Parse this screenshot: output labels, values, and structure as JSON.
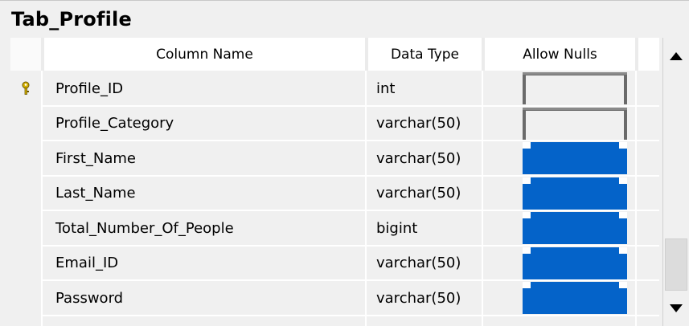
{
  "table": {
    "title": "Tab_Profile",
    "headers": {
      "column_name": "Column Name",
      "data_type": "Data Type",
      "allow_nulls": "Allow Nulls"
    },
    "rows": [
      {
        "name": "Profile_ID",
        "type": "int",
        "allow_nulls": false,
        "primary_key": true
      },
      {
        "name": "Profile_Category",
        "type": "varchar(50)",
        "allow_nulls": false,
        "primary_key": false
      },
      {
        "name": "First_Name",
        "type": "varchar(50)",
        "allow_nulls": true,
        "primary_key": false
      },
      {
        "name": "Last_Name",
        "type": "varchar(50)",
        "allow_nulls": true,
        "primary_key": false
      },
      {
        "name": "Total_Number_Of_People",
        "type": "bigint",
        "allow_nulls": true,
        "primary_key": false
      },
      {
        "name": "Email_ID",
        "type": "varchar(50)",
        "allow_nulls": true,
        "primary_key": false
      },
      {
        "name": "Password",
        "type": "varchar(50)",
        "allow_nulls": true,
        "primary_key": false
      }
    ]
  },
  "colors": {
    "checked": "#0463c9",
    "background": "#f0f0f0",
    "key_icon": "#d4b000"
  },
  "icons": {
    "primary_key": "key-icon",
    "scroll_up": "triangle-up-icon",
    "scroll_down": "triangle-down-icon"
  }
}
